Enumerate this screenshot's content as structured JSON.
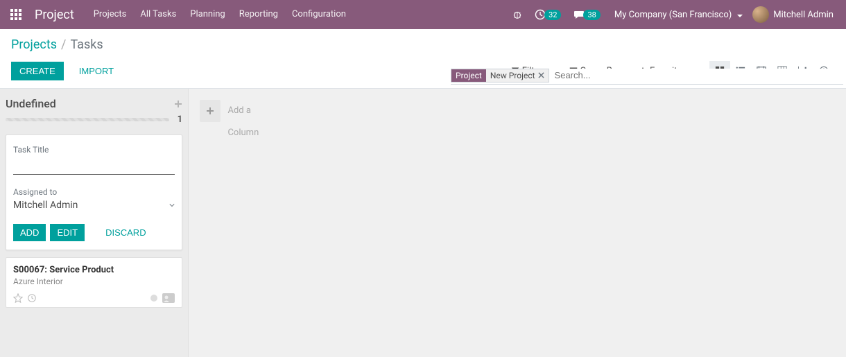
{
  "navbar": {
    "brand": "Project",
    "links": [
      "Projects",
      "All Tasks",
      "Planning",
      "Reporting",
      "Configuration"
    ],
    "timer_badge": "32",
    "chat_badge": "38",
    "company": "My Company (San Francisco)",
    "user": "Mitchell Admin"
  },
  "breadcrumbs": {
    "parent": "Projects",
    "current": "Tasks"
  },
  "buttons": {
    "create": "CREATE",
    "import": "IMPORT"
  },
  "search": {
    "facet_category": "Project",
    "facet_value": "New Project",
    "placeholder": "Search..."
  },
  "filters": {
    "filters": "Filters",
    "group_by": "Group By",
    "favorites": "Favorites"
  },
  "kanban": {
    "column": {
      "title": "Undefined",
      "count": "1",
      "quick_create": {
        "title_label": "Task Title",
        "assigned_label": "Assigned to",
        "assigned_value": "Mitchell Admin",
        "add": "ADD",
        "edit": "EDIT",
        "discard": "DISCARD"
      },
      "card": {
        "title": "S00067: Service Product",
        "subtitle": "Azure Interior"
      }
    },
    "add_column": "Add a Column"
  }
}
